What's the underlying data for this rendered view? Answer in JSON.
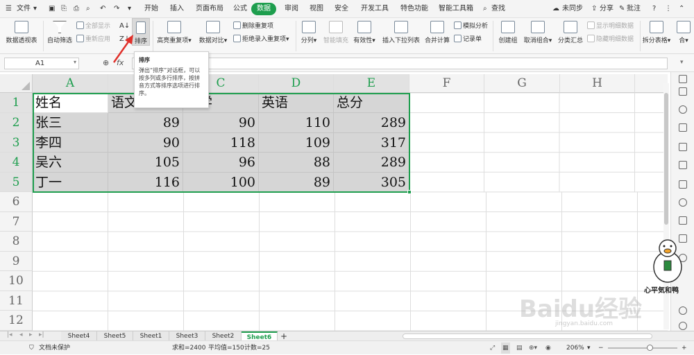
{
  "menu": {
    "file": "文件",
    "tabs": [
      "开始",
      "插入",
      "页面布局",
      "公式",
      "数据",
      "审阅",
      "视图",
      "安全",
      "开发工具",
      "特色功能",
      "智能工具箱"
    ],
    "active_tab": "数据",
    "search": "查找",
    "sync": "未同步",
    "share": "分享",
    "comment": "批注",
    "help": "?"
  },
  "ribbon": {
    "pivot": "数据透视表",
    "autofilter": "自动筛选",
    "show_all": "全部显示",
    "reapply": "重新应用",
    "sort": "排序",
    "highlight_dup": "高亮重复项",
    "compare": "数据对比",
    "delete_dup": "删除重复项",
    "reject_dup": "拒绝录入重复项",
    "split": "分列",
    "smart_fill": "智能填充",
    "validity": "有效性",
    "dropdown": "插入下拉列表",
    "merge_calc": "合并计算",
    "simulate": "模拟分析",
    "record": "记录单",
    "group": "创建组",
    "ungroup": "取消组合",
    "subtotal": "分类汇总",
    "show_detail": "显示明细数据",
    "hide_detail": "隐藏明细数据",
    "split_table": "拆分表格",
    "more": "合"
  },
  "formula_bar": {
    "cell_ref": "A1",
    "fx": "fx",
    "value": ""
  },
  "tooltip": {
    "title": "排序",
    "body": "弹出“排序”对话框，可以按多列或多行排序，按拼音方式等排序选项进行排序。"
  },
  "columns": [
    "A",
    "B",
    "C",
    "D",
    "E",
    "F",
    "G",
    "H"
  ],
  "rows": [
    "1",
    "2",
    "3",
    "4",
    "5",
    "6",
    "7",
    "8",
    "9",
    "10",
    "11",
    "12"
  ],
  "table": {
    "headers": [
      "姓名",
      "语文",
      "数学",
      "英语",
      "总分"
    ],
    "rows": [
      [
        "张三",
        "89",
        "90",
        "110",
        "289"
      ],
      [
        "李四",
        "90",
        "118",
        "109",
        "317"
      ],
      [
        "吴六",
        "105",
        "96",
        "88",
        "289"
      ],
      [
        "丁一",
        "116",
        "100",
        "89",
        "305"
      ]
    ]
  },
  "sheets": [
    "Sheet4",
    "Sheet5",
    "Sheet1",
    "Sheet3",
    "Sheet2",
    "Sheet6"
  ],
  "active_sheet": "Sheet6",
  "add_sheet": "+",
  "status": {
    "protect": "文档未保护",
    "sum": "求和=2400",
    "avg": "平均值=150",
    "count": "计数=25",
    "zoom": "206%"
  },
  "watermark": "Baidu经验",
  "watermark_url": "jingyan.baidu.com",
  "sticker_text": "心平気和鸭",
  "colors": {
    "accent": "#1e9e4e",
    "selection": "#d6d6d6",
    "arrow": "#e0302a"
  }
}
